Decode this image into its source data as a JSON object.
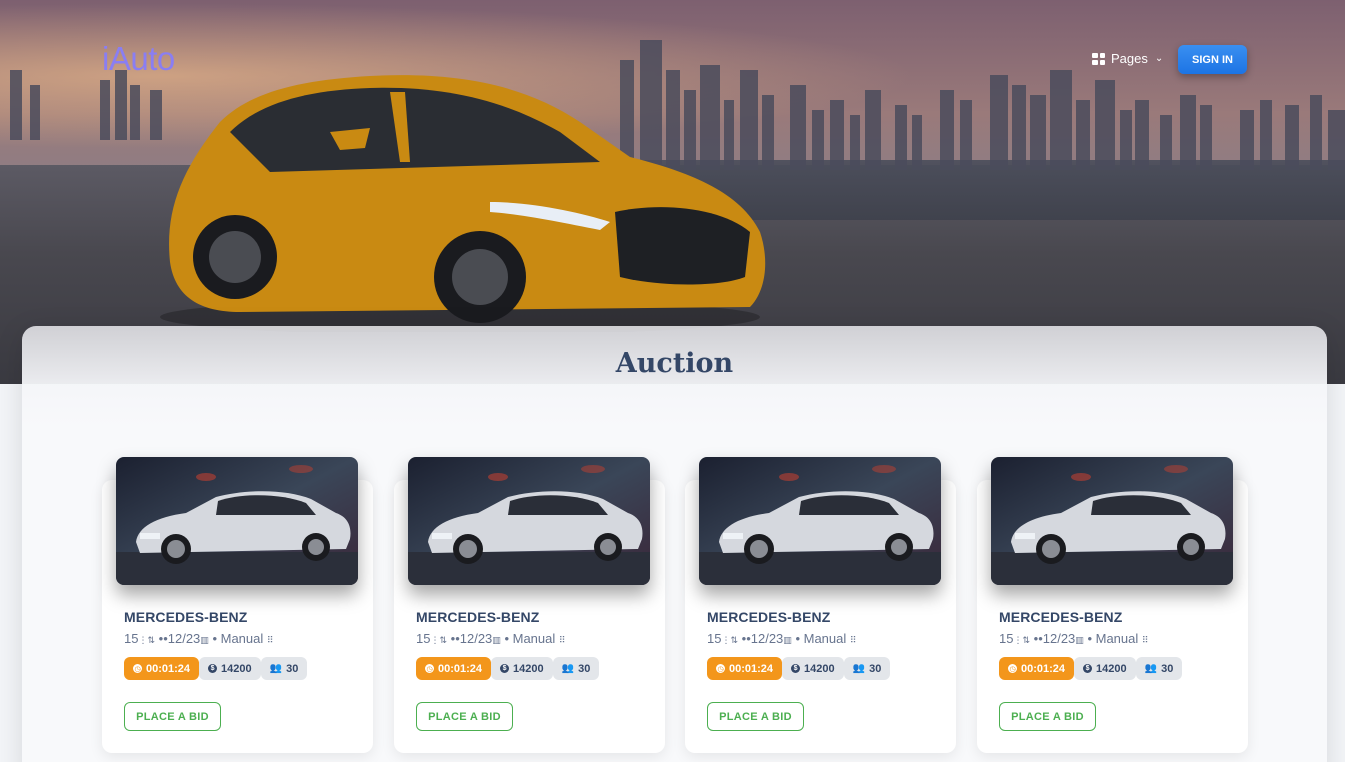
{
  "header": {
    "brand": "iAuto",
    "nav_pages_label": "Pages",
    "signin_label": "SIGN IN"
  },
  "auction": {
    "title": "Auction",
    "bid_label": "PLACE A BID",
    "cards": [
      {
        "name": "MERCEDES-BENZ",
        "year": "15",
        "date": "12/23",
        "transmission": "Manual",
        "timer": "00:01:24",
        "price": "14200",
        "bidders": "30"
      },
      {
        "name": "MERCEDES-BENZ",
        "year": "15",
        "date": "12/23",
        "transmission": "Manual",
        "timer": "00:01:24",
        "price": "14200",
        "bidders": "30"
      },
      {
        "name": "MERCEDES-BENZ",
        "year": "15",
        "date": "12/23",
        "transmission": "Manual",
        "timer": "00:01:24",
        "price": "14200",
        "bidders": "30"
      },
      {
        "name": "MERCEDES-BENZ",
        "year": "15",
        "date": "12/23",
        "transmission": "Manual",
        "timer": "00:01:24",
        "price": "14200",
        "bidders": "30"
      }
    ]
  },
  "icons": {
    "pages": "grid-icon",
    "chevron": "chevron-down-icon",
    "timer": "clock-icon",
    "price": "coin-icon",
    "bidders": "users-icon"
  },
  "colors": {
    "brand": "#8a7ef2",
    "primary": "#1c74e5",
    "timer": "#f3961b",
    "success": "#4caf50",
    "heading": "#344767"
  }
}
